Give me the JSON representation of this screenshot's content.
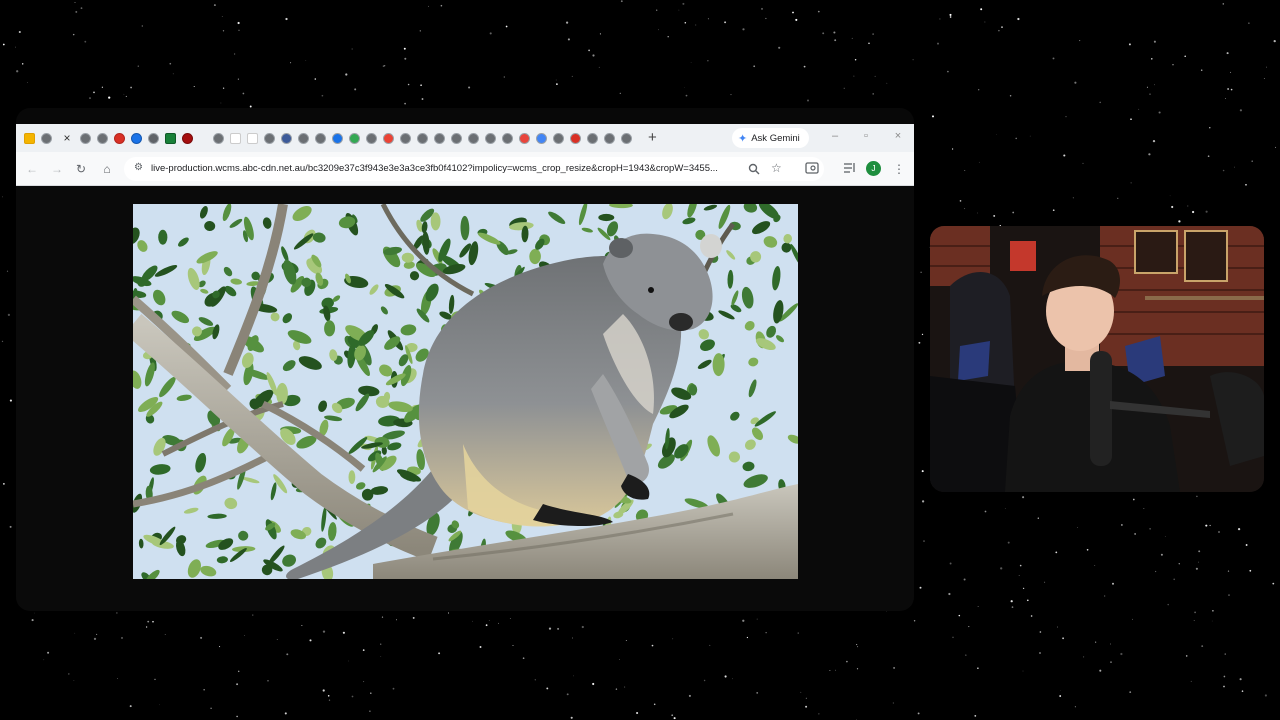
{
  "browser": {
    "tabs": {
      "close_glyph": "×",
      "new_tab_glyph": "+"
    },
    "gemini_label": "Ask Gemini",
    "url": "live-production.wcms.abc-cdn.net.au/bc3209e37c3f943e3e3a3ce3fb0f4102?impolicy=wcms_crop_resize&cropH=1943&cropW=3455...",
    "profile_initial": "J",
    "nav": {
      "back": "←",
      "forward": "→",
      "reload": "↻",
      "home": "⌂"
    },
    "window_controls": {
      "minimize": "–",
      "restore": "▫",
      "close": "×"
    }
  },
  "image": {
    "subject": "tree-kangaroo on branch",
    "colors": {
      "fur": "#8c8f91",
      "leaves": "#3f7a35",
      "sky": "#dce8f4",
      "branch": "#a8a49a"
    }
  },
  "webcam": {
    "subject": "streamer at desk with microphone",
    "colors": {
      "wall": "#6b2f22",
      "shirt": "#141414",
      "chair": "#2a3a7a"
    }
  }
}
